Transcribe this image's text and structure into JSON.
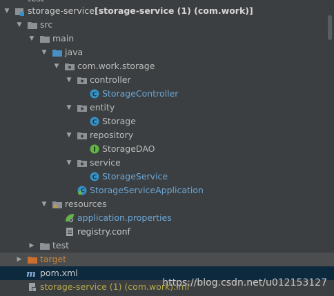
{
  "tree": {
    "partial_top": "test",
    "root": "storage-service",
    "root_detail": "[storage-service (1) (com.work)]",
    "items": [
      {
        "label": "src"
      },
      {
        "label": "main"
      },
      {
        "label": "java"
      },
      {
        "label": "com.work.storage"
      },
      {
        "label": "controller"
      },
      {
        "label": "StorageController"
      },
      {
        "label": "entity"
      },
      {
        "label": "Storage"
      },
      {
        "label": "repository"
      },
      {
        "label": "StorageDAO"
      },
      {
        "label": "service"
      },
      {
        "label": "StorageService"
      },
      {
        "label": "StorageServiceApplication"
      },
      {
        "label": "resources"
      },
      {
        "label": "application.properties"
      },
      {
        "label": "registry.conf"
      },
      {
        "label": "test"
      },
      {
        "label": "target"
      },
      {
        "label": "pom.xml"
      },
      {
        "label": "storage-service (1) (com.work).iml"
      }
    ]
  },
  "watermark": "https://blog.csdn.net/u012153127",
  "colors": {
    "background": "#3c3f41",
    "selected_blue": "#0d293e",
    "class_blue": "#6aa7d8",
    "target_orange": "#cc8a3c"
  }
}
